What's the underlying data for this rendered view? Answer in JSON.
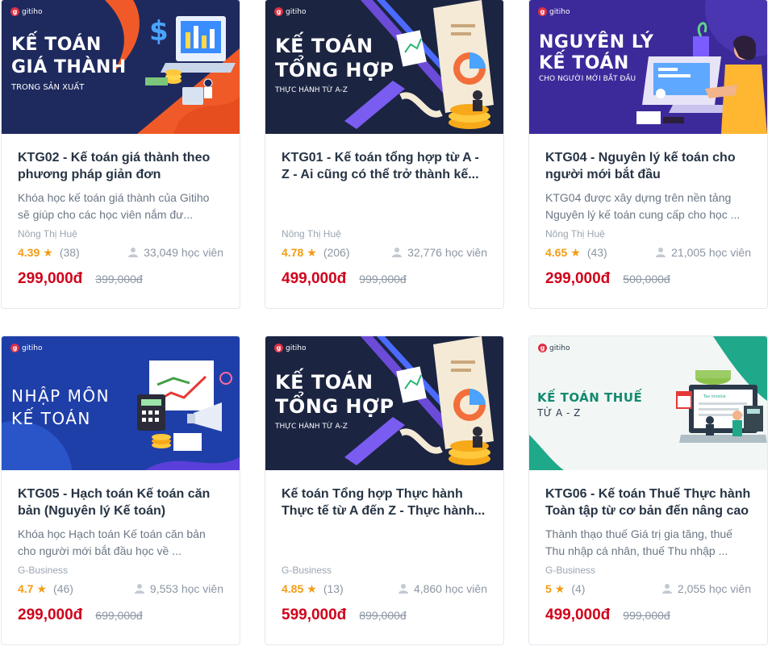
{
  "brand": "gitiho",
  "courses": [
    {
      "banner_title_1": "KẾ TOÁN",
      "banner_title_2": "GIÁ THÀNH",
      "banner_sub": "TRONG SẢN XUẤT",
      "title": "KTG02 - Kế toán giá thành theo phương pháp giản đơn",
      "description": "Khóa học kế toán giá thành của Gitiho sẽ giúp cho các học viên nắm đư...",
      "author": "Nông Thị Huệ",
      "rating": "4.39",
      "reviews": "(38)",
      "students": "33,049 học viên",
      "price": "299,000đ",
      "old_price": "399,000đ"
    },
    {
      "banner_title_1": "KẾ TOÁN",
      "banner_title_2": "TỔNG HỢP",
      "banner_sub": "THỰC HÀNH TỪ A-Z",
      "title": "KTG01 - Kế toán tổng hợp từ A - Z - Ai cũng có thể trở thành kế...",
      "description": "",
      "author": "Nông Thị Huệ",
      "rating": "4.78",
      "reviews": "(206)",
      "students": "32,776 học viên",
      "price": "499,000đ",
      "old_price": "999,000đ"
    },
    {
      "banner_title_1": "NGUYÊN LÝ",
      "banner_title_2": "KẾ TOÁN",
      "banner_sub": "CHO NGƯỜI MỚI BẮT ĐẦU",
      "title": "KTG04 - Nguyên lý kế toán cho người mới bắt đầu",
      "description": "KTG04 được xây dựng trên nền tảng Nguyên lý kế toán cung cấp cho học ...",
      "author": "Nông Thị Huệ",
      "rating": "4.65",
      "reviews": "(43)",
      "students": "21,005 học viên",
      "price": "299,000đ",
      "old_price": "500,000đ"
    },
    {
      "banner_title_1": "NHẬP MÔN",
      "banner_title_2": "KẾ TOÁN",
      "banner_sub": "",
      "title": "KTG05 - Hạch toán Kế toán căn bản (Nguyên lý Kế toán)",
      "description": "Khóa học Hạch toán Kế toán căn bản cho người mới bắt đầu học về ...",
      "author": "G-Business",
      "rating": "4.7",
      "reviews": "(46)",
      "students": "9,553 học viên",
      "price": "299,000đ",
      "old_price": "699,000đ"
    },
    {
      "banner_title_1": "KẾ TOÁN",
      "banner_title_2": "TỔNG HỢP",
      "banner_sub": "THỰC HÀNH TỪ A-Z",
      "title": "Kế toán Tổng hợp Thực hành Thực tế từ A đến Z - Thực hành...",
      "description": "",
      "author": "G-Business",
      "rating": "4.85",
      "reviews": "(13)",
      "students": "4,860 học viên",
      "price": "599,000đ",
      "old_price": "899,000đ"
    },
    {
      "banner_title_1": "KẾ TOÁN THUẾ",
      "banner_title_2": "TỪ A - Z",
      "banner_sub": "",
      "title": "KTG06 - Kế toán Thuế Thực hành Toàn tập từ cơ bản đến nâng cao",
      "description": "Thành thạo thuế Giá trị gia tăng, thuế Thu nhập cá nhân, thuế Thu nhập ...",
      "author": "G-Business",
      "rating": "5",
      "reviews": "(4)",
      "students": "2,055 học viên",
      "price": "499,000đ",
      "old_price": "999,000đ"
    }
  ],
  "colors": {
    "price": "#d0021b",
    "rating": "#f39c12",
    "banner_navy": "#1e2a5e",
    "banner_dark": "#1b2441",
    "banner_purple": "#3d2a9a",
    "banner_blue": "#1f3fa8",
    "banner_light": "#f2f7f5"
  },
  "icons": [
    "gitiho-logo-icon",
    "star-icon",
    "student-icon"
  ]
}
